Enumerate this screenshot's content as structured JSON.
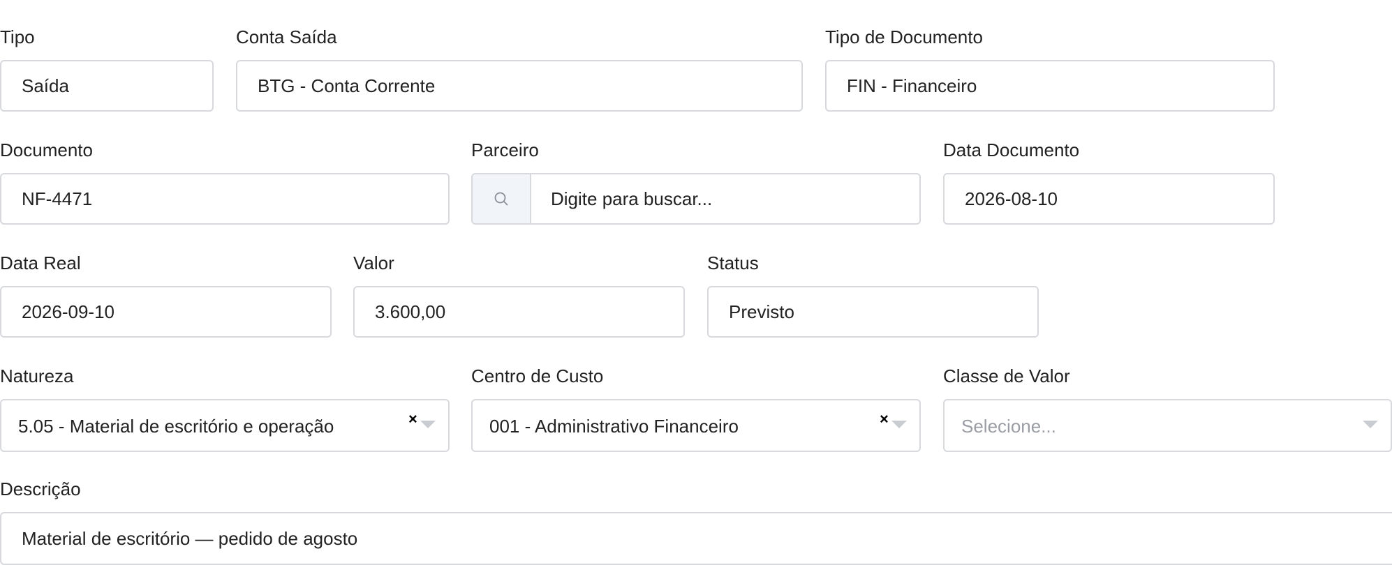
{
  "form": {
    "tipo": {
      "label": "Tipo",
      "value": "Saída"
    },
    "conta_saida": {
      "label": "Conta Saída",
      "value": "BTG - Conta Corrente"
    },
    "tipo_documento": {
      "label": "Tipo de Documento",
      "value": "FIN - Financeiro"
    },
    "documento": {
      "label": "Documento",
      "value": "NF-4471"
    },
    "parceiro": {
      "label": "Parceiro",
      "placeholder": "Digite para buscar..."
    },
    "data_documento": {
      "label": "Data Documento",
      "value": "2026-08-10"
    },
    "data_real": {
      "label": "Data Real",
      "value": "2026-09-10"
    },
    "valor": {
      "label": "Valor",
      "value": "3.600,00"
    },
    "status": {
      "label": "Status",
      "value": "Previsto"
    },
    "natureza": {
      "label": "Natureza",
      "value": "5.05 - Material de escritório e operação",
      "clear": "×"
    },
    "centro_custo": {
      "label": "Centro de Custo",
      "value": "001 - Administrativo Financeiro",
      "clear": "×"
    },
    "classe_valor": {
      "label": "Classe de Valor",
      "placeholder": "Selecione..."
    },
    "descricao": {
      "label": "Descrição",
      "value": "Material de escritório — pedido de agosto"
    }
  },
  "icons": {
    "search": "search-icon",
    "clear": "close-icon",
    "dropdown": "chevron-down-icon"
  },
  "colors": {
    "border": "#d7d9dd",
    "addon_bg": "#f1f4f8",
    "placeholder": "#9a9da3",
    "text": "#222222"
  }
}
